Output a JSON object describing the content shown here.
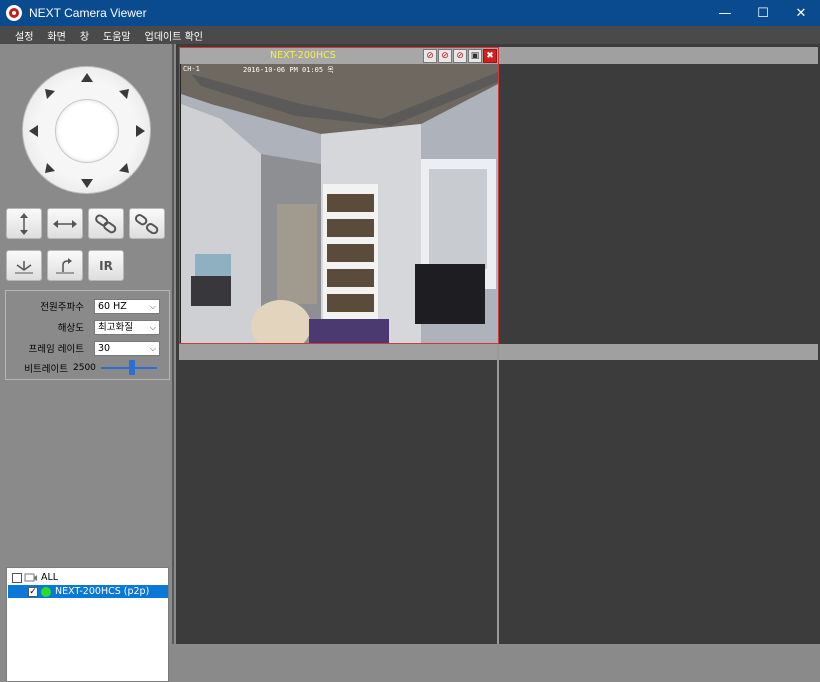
{
  "window": {
    "title": "NEXT Camera Viewer",
    "minimize": "—",
    "maximize": "☐",
    "close": "✕"
  },
  "menu": [
    "설정",
    "화면",
    "창",
    "도움말",
    "업데이트 확인"
  ],
  "tools": {
    "ir_label": "IR"
  },
  "settings": {
    "rows": [
      {
        "label": "전원주파수",
        "value": "60 HZ"
      },
      {
        "label": "해상도",
        "value": "최고화질"
      },
      {
        "label": "프레임 레이트",
        "value": "30"
      }
    ],
    "bitrate_label": "비트레이트",
    "bitrate_value": "2500",
    "bitrate_level": 0.55
  },
  "camera_list": {
    "all_label": "ALL",
    "items": [
      {
        "name": "NEXT-200HCS (p2p)",
        "status_color": "#2bdc2b",
        "checked_mark": "✓",
        "highlight": "#0a78d7"
      }
    ]
  },
  "camera": {
    "name": "NEXT-200HCS",
    "timestamp": "2016-10-06 PM 01:05 목",
    "corner": "CH-1",
    "close_icon": "✖"
  },
  "colors": {
    "titlebar": "#0a4a8f",
    "selection": "#0a78d7",
    "cam_name": "#f5f04a"
  }
}
